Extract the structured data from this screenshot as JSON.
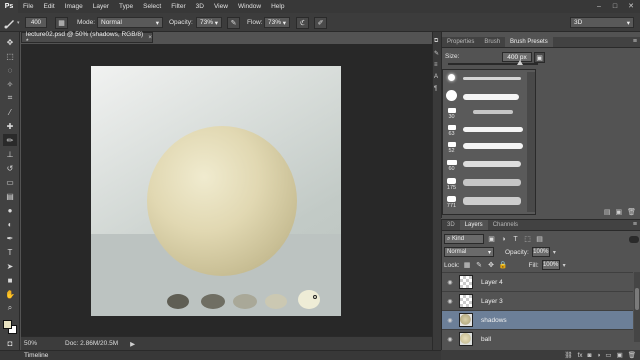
{
  "app": {
    "logo": "Ps",
    "menu": [
      "File",
      "Edit",
      "Image",
      "Layer",
      "Type",
      "Select",
      "Filter",
      "3D",
      "View",
      "Window",
      "Help"
    ],
    "window_controls": [
      "–",
      "□",
      "✕"
    ]
  },
  "options_bar": {
    "brush_size": "400",
    "mode_label": "Mode:",
    "mode_value": "Normal",
    "opacity_label": "Opacity:",
    "opacity_value": "73%",
    "flow_label": "Flow:",
    "flow_value": "73%",
    "workspace_value": "3D"
  },
  "document": {
    "tab_title": "lecture02.psd @ 50% (shadows, RGB/8) *",
    "tab_close": "×",
    "zoom": "50%",
    "doc_info": "Doc: 2.86M/20.5M",
    "status_arrow": "▶"
  },
  "colors": {
    "accent_selected_layer": "#6c7f98",
    "foreground_color": "#e8e2c0",
    "background_color": "#ffffff",
    "swatches": [
      "#5f5e54",
      "#6f6e63",
      "#a9a898",
      "#cbc8b2",
      "#eeecd6"
    ]
  },
  "brush_panel": {
    "tabs": [
      "Properties",
      "Brush",
      "Brush Presets"
    ],
    "active_tab": "Brush Presets",
    "size_label": "Size:",
    "size_value": "400 px",
    "size_fraction": 0.8,
    "presets": [
      {
        "num": ""
      },
      {
        "num": ""
      },
      {
        "num": "30"
      },
      {
        "num": "63"
      },
      {
        "num": "52"
      },
      {
        "num": "60"
      },
      {
        "num": "175"
      },
      {
        "num": "771"
      }
    ]
  },
  "layers_panel": {
    "tabs": [
      "3D",
      "Layers",
      "Channels"
    ],
    "active_tab": "Layers",
    "filter_kind": "Kind",
    "blend_mode": "Normal",
    "opacity_label": "Opacity:",
    "opacity_value": "100%",
    "lock_label": "Lock:",
    "fill_label": "Fill:",
    "fill_value": "100%",
    "layers": [
      {
        "name": "Layer 4",
        "selected": false
      },
      {
        "name": "Layer 3",
        "selected": false
      },
      {
        "name": "shadows",
        "selected": true
      },
      {
        "name": "ball",
        "selected": false
      }
    ]
  },
  "timeline": {
    "label": "Timeline"
  }
}
